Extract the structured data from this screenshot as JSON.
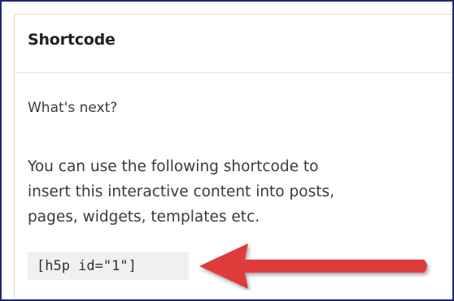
{
  "panel": {
    "title": "Shortcode",
    "whats_next": "What's next?",
    "description_lines": [
      "You can use the following shortcode to",
      "insert this interactive content into posts,",
      "pages, widgets, templates etc."
    ],
    "shortcode": "[h5p id=\"1\"]"
  },
  "annotation": {
    "arrow_color": "#e03a3a",
    "arrow_direction": "left"
  },
  "colors": {
    "frame_border": "#1f2a6b",
    "code_background": "#f0f0f0",
    "text": "#3a3a3a",
    "title": "#222222"
  }
}
